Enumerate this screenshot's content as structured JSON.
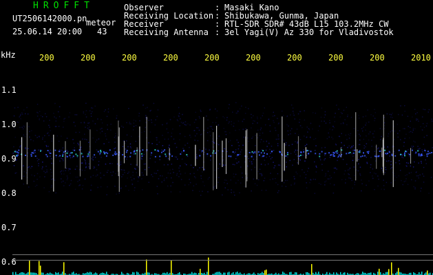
{
  "header": {
    "app_title": "HROFFT",
    "file_name": "UT2506142000.pn",
    "meteor_label": "meteor",
    "date_time": "25.06.14 20:00",
    "count": "43"
  },
  "meta": [
    {
      "key": "Observer",
      "value": "Masaki Kano"
    },
    {
      "key": "Receiving Location",
      "value": "Shibukawa, Gunma, Japan"
    },
    {
      "key": "Receiver",
      "value": "RTL-SDR SDR# 43dB L15 103.2MHz CW"
    },
    {
      "key": "Receiving Antenna",
      "value": "3el Yagi(V) Az 330 for Vladivostok"
    }
  ],
  "time_axis": {
    "labels": [
      "200",
      "200",
      "200",
      "200",
      "200",
      "200",
      "200",
      "200",
      "200",
      "2010"
    ]
  },
  "freq_axis": {
    "unit": "kHz",
    "labels": [
      "1.1",
      "1.0",
      "0.9",
      "0.8",
      "0.7",
      "0.6"
    ]
  },
  "colors": {
    "title": "#00e000",
    "time_labels": "#ffff40",
    "background": "#000000",
    "noise_band": "#1a1a8c",
    "echo": "#ffffff",
    "activity_bar": "#ffff00",
    "activity_base": "#00e0e0"
  }
}
